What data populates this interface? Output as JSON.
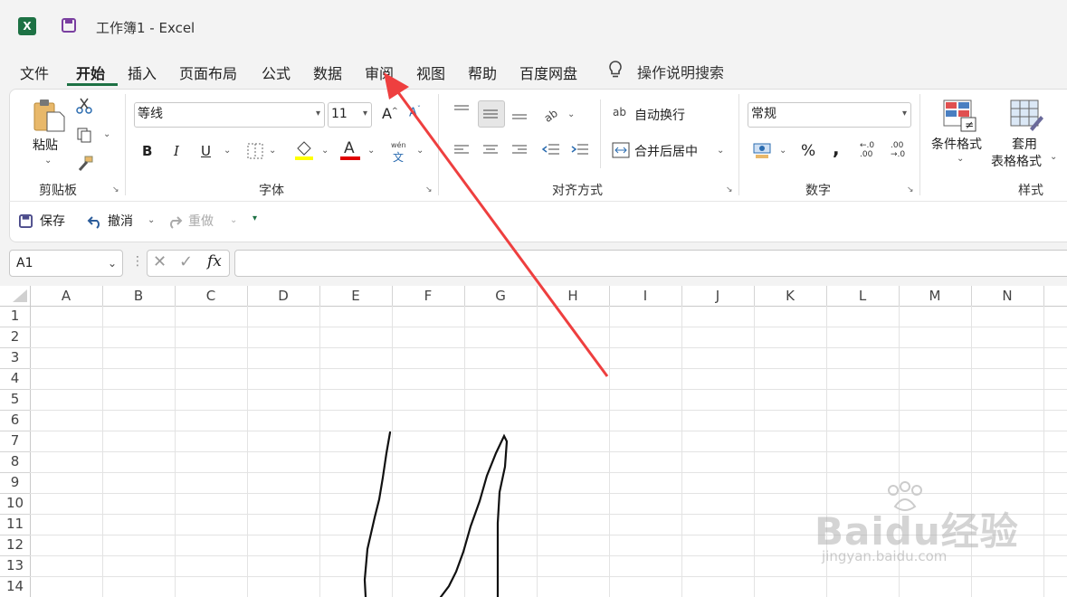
{
  "titlebar": {
    "doc_title": "工作簿1  -  Excel",
    "app_icon_letter": "X"
  },
  "tabs": [
    "文件",
    "开始",
    "插入",
    "页面布局",
    "公式",
    "数据",
    "审阅",
    "视图",
    "帮助",
    "百度网盘"
  ],
  "tell_me": "操作说明搜索",
  "clipboard": {
    "paste": "粘贴",
    "group": "剪贴板"
  },
  "font": {
    "name": "等线",
    "size": "11",
    "group": "字体",
    "bold": "B",
    "italic": "I",
    "underline": "U",
    "font_color_letter": "A",
    "phonetic_top": "wén",
    "phonetic_bottom": "文"
  },
  "alignment": {
    "wrap": "自动换行",
    "merge": "合并后居中",
    "group": "对齐方式"
  },
  "number": {
    "format": "常规",
    "group": "数字",
    "percent": "%",
    "comma": ","
  },
  "styles": {
    "conditional": "条件格式",
    "table_line1": "套用",
    "table_line2": "表格格式",
    "group": "样式"
  },
  "qat": {
    "save": "保存",
    "undo": "撤消",
    "redo": "重做"
  },
  "formula_bar": {
    "name_box": "A1",
    "fx": "fx"
  },
  "columns": [
    "A",
    "B",
    "C",
    "D",
    "E",
    "F",
    "G",
    "H",
    "I",
    "J",
    "K",
    "L",
    "M",
    "N"
  ],
  "rows": [
    "1",
    "2",
    "3",
    "4",
    "5",
    "6",
    "7",
    "8",
    "9",
    "10",
    "11",
    "12",
    "13",
    "14"
  ],
  "watermark": {
    "brand": "Baidu经验",
    "url": "jingyan.baidu.com"
  },
  "colors": {
    "accent": "#1d7144",
    "arrow": "#ee3f3f"
  }
}
